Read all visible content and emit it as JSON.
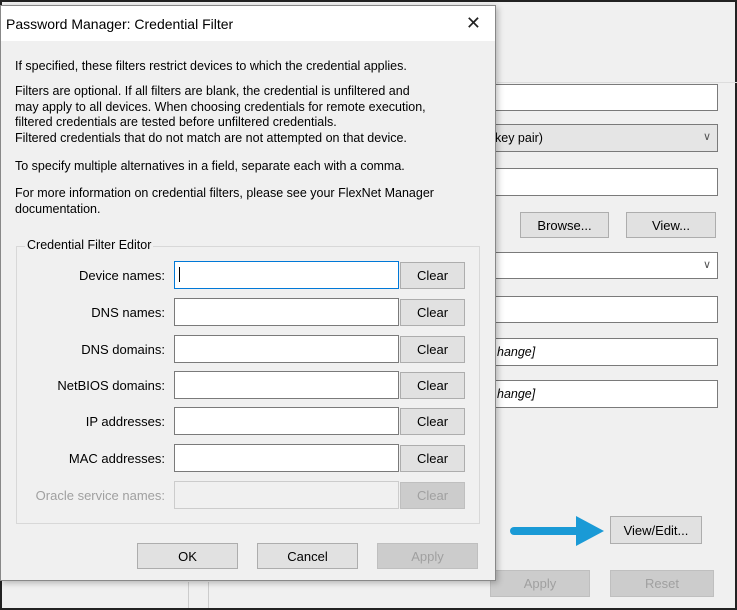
{
  "background_window": {
    "combo1_text": "key pair)",
    "browse_label": "Browse...",
    "view_label": "View...",
    "field_a_text": "hange]",
    "field_b_text": "hange]",
    "view_edit_label": "View/Edit...",
    "apply_label": "Apply",
    "reset_label": "Reset",
    "arrow_color": "#1a9ad6"
  },
  "dialog": {
    "title": "Password Manager: Credential Filter",
    "close_icon": "close-icon",
    "intro": "If specified, these filters restrict devices to which the credential applies.",
    "optional_lines": [
      "Filters are optional. If all filters are blank, the credential is unfiltered and",
      "may apply to all devices. When choosing credentials for remote execution,",
      "filtered credentials are tested before unfiltered credentials.",
      "Filtered credentials that do not match are not attempted on that device."
    ],
    "multiple": "To specify multiple alternatives in a field, separate each with a comma.",
    "more_info": [
      "For more information on credential filters, please see your FlexNet Manager",
      "documentation."
    ],
    "group_title": "Credential Filter Editor",
    "fields": [
      {
        "label": "Device names:",
        "value": "",
        "clear": "Clear",
        "enabled": true
      },
      {
        "label": "DNS names:",
        "value": "",
        "clear": "Clear",
        "enabled": true
      },
      {
        "label": "DNS domains:",
        "value": "",
        "clear": "Clear",
        "enabled": true
      },
      {
        "label": "NetBIOS domains:",
        "value": "",
        "clear": "Clear",
        "enabled": true
      },
      {
        "label": "IP addresses:",
        "value": "",
        "clear": "Clear",
        "enabled": true
      },
      {
        "label": "MAC addresses:",
        "value": "",
        "clear": "Clear",
        "enabled": true
      },
      {
        "label": "Oracle service names:",
        "value": "",
        "clear": "Clear",
        "enabled": false
      }
    ],
    "ok_label": "OK",
    "cancel_label": "Cancel",
    "apply_label": "Apply"
  }
}
